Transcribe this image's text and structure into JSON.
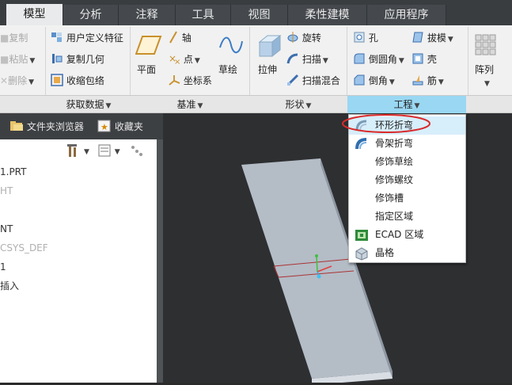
{
  "tabs": [
    {
      "label": "模型",
      "active": true
    },
    {
      "label": "分析"
    },
    {
      "label": "注释"
    },
    {
      "label": "工具"
    },
    {
      "label": "视图"
    },
    {
      "label": "柔性建模"
    },
    {
      "label": "应用程序"
    }
  ],
  "ribbon": {
    "operations": {
      "copy": "复制",
      "paste": "粘贴",
      "delete": "删除"
    },
    "get_data": {
      "udf": "用户定义特征",
      "copy_geom": "复制几何",
      "shrinkwrap": "收缩包络",
      "label": "获取数据"
    },
    "datum": {
      "plane": "平面",
      "axis": "轴",
      "point": "点",
      "csys": "坐标系",
      "sketch": "草绘",
      "label": "基准"
    },
    "shapes": {
      "extrude": "拉伸",
      "revolve": "旋转",
      "sweep": "扫描",
      "swept_blend": "扫描混合",
      "label": "形状"
    },
    "engineering": {
      "hole": "孔",
      "round": "倒圆角",
      "chamfer": "倒角",
      "draft": "拔模",
      "shell": "壳",
      "rib": "筋",
      "label": "工程"
    },
    "pattern": {
      "label": "阵列"
    }
  },
  "left_panel": {
    "tab_folder": "文件夹浏览器",
    "tab_fav": "收藏夹",
    "tree": [
      "1.PRT",
      "HT",
      "",
      "NT",
      "CSYS_DEF",
      "1",
      "插入"
    ]
  },
  "dropdown": {
    "items": [
      {
        "label": "环形折弯",
        "highlight": true
      },
      {
        "label": "骨架折弯"
      },
      {
        "label": "修饰草绘"
      },
      {
        "label": "修饰螺纹"
      },
      {
        "label": "修饰槽"
      },
      {
        "label": "指定区域"
      },
      {
        "label": "ECAD 区域"
      },
      {
        "label": "晶格"
      }
    ]
  }
}
